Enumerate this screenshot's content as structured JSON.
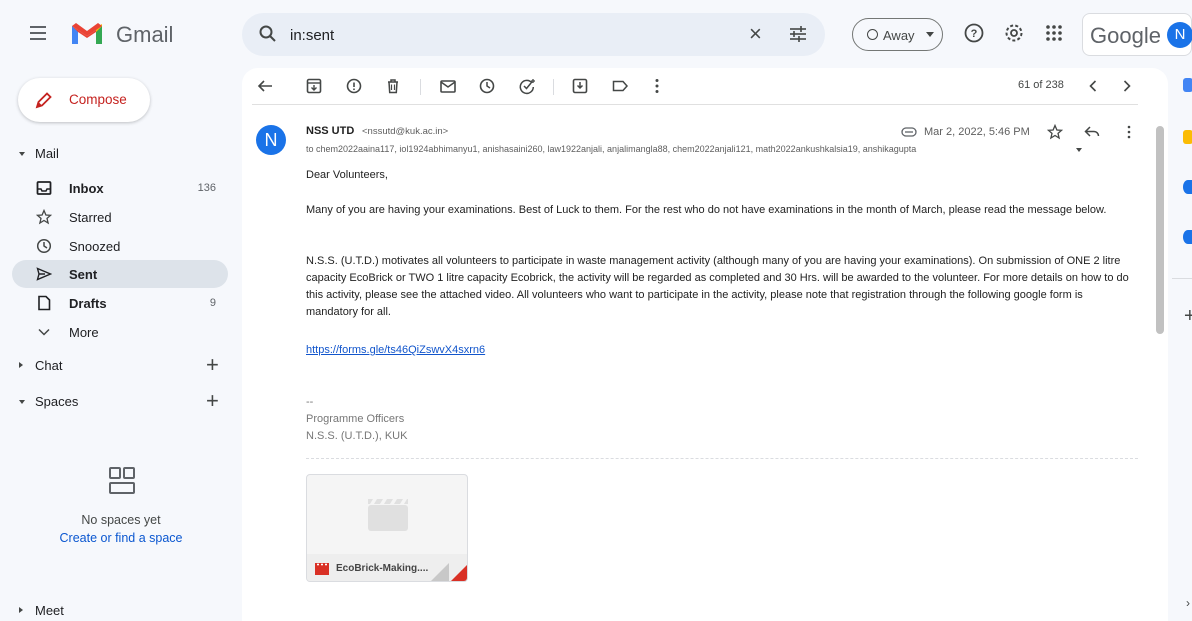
{
  "app": {
    "brand": "Gmail"
  },
  "search": {
    "value": "in:sent"
  },
  "status": {
    "label": "Away"
  },
  "account": {
    "wordmark": "Google",
    "initial": "N"
  },
  "compose": {
    "label": "Compose"
  },
  "sidebar": {
    "mail_section": "Mail",
    "items": [
      {
        "label": "Inbox",
        "count": "136",
        "icon": "inbox-icon",
        "bold": true
      },
      {
        "label": "Starred",
        "count": "",
        "icon": "star-icon",
        "bold": false
      },
      {
        "label": "Snoozed",
        "count": "",
        "icon": "clock-icon",
        "bold": false
      },
      {
        "label": "Sent",
        "count": "",
        "icon": "send-icon",
        "bold": true
      },
      {
        "label": "Drafts",
        "count": "9",
        "icon": "draft-icon",
        "bold": true
      },
      {
        "label": "More",
        "count": "",
        "icon": "chevron-down-icon",
        "bold": false
      }
    ],
    "chat_section": "Chat",
    "spaces_section": "Spaces",
    "no_spaces": "No spaces yet",
    "create_space": "Create or find a space",
    "meet_section": "Meet"
  },
  "toolbar": {
    "pager": "61 of 238"
  },
  "message": {
    "sender_initial": "N",
    "sender_name": "NSS UTD",
    "sender_email": "<nssutd@kuk.ac.in>",
    "date": "Mar 2, 2022, 5:46 PM",
    "recipients": "to chem2022aaina117, iol1924abhimanyu1, anishasaini260, law1922anjali, anjalimangla88, chem2022anjali121, math2022ankushkalsia19, anshikagupta",
    "greeting": "Dear Volunteers,",
    "para1": " Many of you are having your examinations. Best of Luck to them. For the rest who do not have examinations in the month of March, please read the message below.",
    "para2": " N.S.S. (U.T.D.) motivates all volunteers to participate in waste management activity (although many of you are having your examinations). On submission of ONE 2 litre capacity EcoBrick or TWO 1 litre capacity Ecobrick, the activity will be regarded as completed and 30 Hrs. will be awarded to the volunteer. For more details on how to do this activity, please see the attached video. All volunteers who want to participate in the activity, please note that registration through the following google form is mandatory for all.",
    "link": "https://forms.gle/ts46QiZswvX4sxrn6",
    "sig_dash": "--",
    "sig_line1": "Programme Officers",
    "sig_line2": "N.S.S. (U.T.D.), KUK",
    "attachment": "EcoBrick-Making...."
  },
  "colors": {
    "accent": "#0b57d0",
    "compose_text": "#c5221f",
    "avatar": "#1a73e8"
  }
}
